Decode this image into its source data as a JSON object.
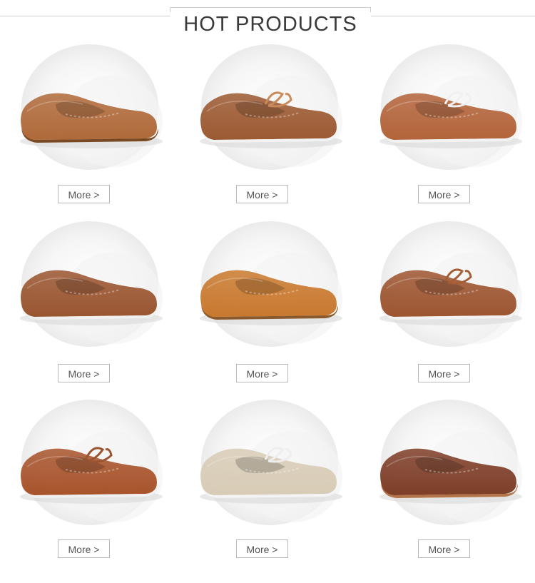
{
  "header": {
    "title": "HOT PRODUCTS"
  },
  "products": [
    {
      "shoe_color": "#b06a3a",
      "sole_color": "#7a4a24",
      "lace": false,
      "more_label": "More >"
    },
    {
      "shoe_color": "#9c5a32",
      "sole_color": "#f2f2f2",
      "lace": true,
      "lace_color": "#c98a5a",
      "more_label": "More >"
    },
    {
      "shoe_color": "#b3643a",
      "sole_color": "#f2f2f2",
      "lace": true,
      "lace_color": "#f0f0f0",
      "more_label": "More >"
    },
    {
      "shoe_color": "#9a5530",
      "sole_color": "#f0f0f0",
      "lace": false,
      "more_label": "More >"
    },
    {
      "shoe_color": "#c9792e",
      "sole_color": "#8a5a2c",
      "lace": false,
      "more_label": "More >"
    },
    {
      "shoe_color": "#9d5530",
      "sole_color": "#f2f2f2",
      "lace": true,
      "lace_color": "#a45d35",
      "more_label": "More >"
    },
    {
      "shoe_color": "#a8542c",
      "sole_color": "#f0f0f0",
      "lace": true,
      "lace_color": "#9a5530",
      "more_label": "More >"
    },
    {
      "shoe_color": "#d8ccb6",
      "sole_color": "#f4f4f4",
      "lace": true,
      "lace_color": "#eeeeee",
      "more_label": "More >"
    },
    {
      "shoe_color": "#7e3e28",
      "sole_color": "#b4744a",
      "lace": false,
      "more_label": "More >"
    }
  ]
}
